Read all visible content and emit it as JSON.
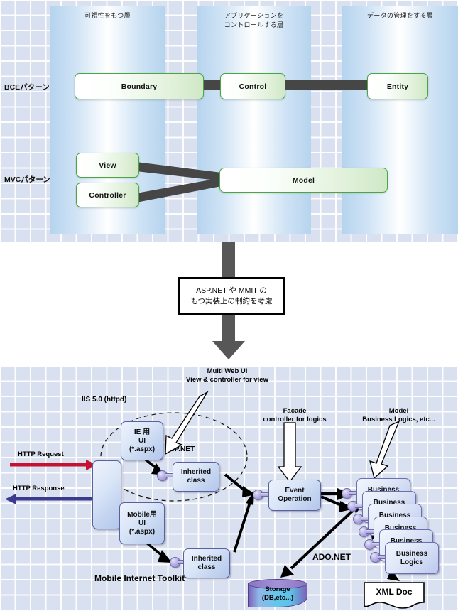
{
  "top_panel": {
    "layers": [
      {
        "label": "可視性をもつ層"
      },
      {
        "label": "アプリケーションを\nコントロールする層"
      },
      {
        "label": "データの管理をする層"
      }
    ],
    "row_labels": [
      {
        "label": "BCEパターン"
      },
      {
        "label": "MVCパターン"
      }
    ],
    "bce_boxes": [
      {
        "label": "Boundary"
      },
      {
        "label": "Control"
      },
      {
        "label": "Entity"
      }
    ],
    "mvc_boxes": [
      {
        "label": "View"
      },
      {
        "label": "Controller"
      },
      {
        "label": "Model"
      }
    ]
  },
  "mid_panel": {
    "note_lines": [
      "ASP.NET や MMIT の",
      "もつ実装上の制約を考慮"
    ]
  },
  "bottom_panel": {
    "callouts": {
      "multi_web_ui": "Multi Web UI\nView & controller for view",
      "facade": "Facade\ncontroller for logics",
      "model": "Model\nBusiness Logics, etc..."
    },
    "iis_label": "IIS 5.0 (httpd)",
    "aspnet_label": "ASP.NET",
    "adonet_label": "ADO.NET",
    "toolkit_label": "Mobile Internet Toolkit",
    "http_request": "HTTP Request",
    "http_response": "HTTP Response",
    "ui_boxes": [
      {
        "label": "IE 用\nUI\n(*.aspx)"
      },
      {
        "label": "Mobile用\nUI\n(*.aspx)"
      }
    ],
    "inherited_boxes": [
      {
        "label": "Inherited\nclass"
      },
      {
        "label": "Inherited\nclass"
      }
    ],
    "event_box": {
      "label": "Event\nOperation"
    },
    "business_boxes": [
      {
        "label": "Business\nLogics"
      },
      {
        "label": "Business\nLogics"
      },
      {
        "label": "Business\nLogics"
      },
      {
        "label": "Business\nLogics"
      },
      {
        "label": "Business\nLogics"
      },
      {
        "label": "Business\nLogics"
      }
    ],
    "storage": {
      "label": "Storage\n(DB,etc...)"
    },
    "xml_doc": {
      "label": "XML Doc"
    }
  },
  "colors": {
    "grid_bg": "#d9e0ef",
    "band_edge": "#b6d4ee",
    "green_border": "#4aa544",
    "gray_connector": "#464646",
    "http_request": "#c41230",
    "http_response": "#3b3a8c",
    "blue_border": "#5a5f9e",
    "arrow_black": "#000000"
  }
}
